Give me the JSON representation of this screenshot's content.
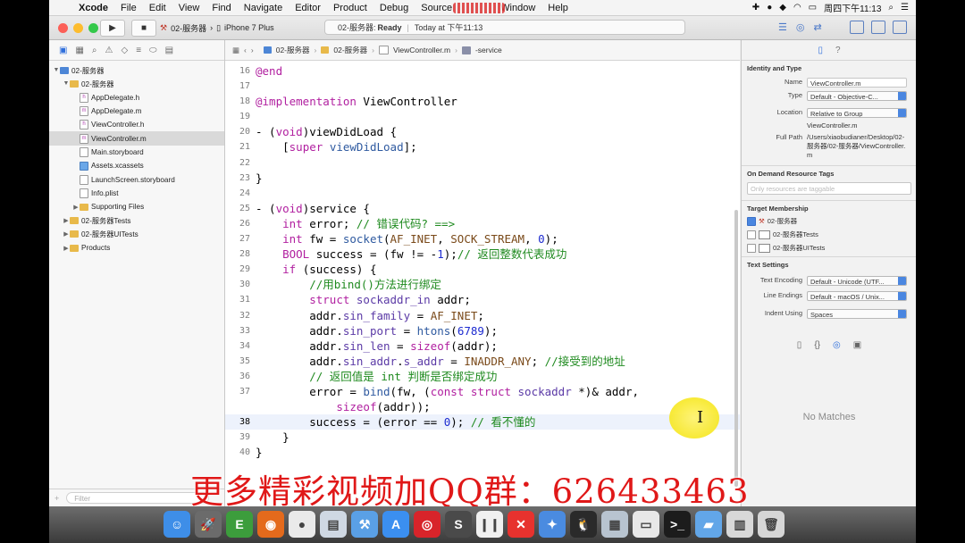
{
  "menubar": {
    "app_name": "Xcode",
    "items": [
      "File",
      "Edit",
      "View",
      "Find",
      "Navigate",
      "Editor",
      "Product",
      "Debug",
      "Source",
      "Window",
      "Help"
    ],
    "clock": "周四下午11:13"
  },
  "toolbar": {
    "scheme": "02-服务器",
    "device": "iPhone 7 Plus",
    "status_project": "02-服务器:",
    "status_text": "Ready",
    "status_time": "Today at 下午11:13",
    "colors": {
      "close": "#fc5f57",
      "minimize": "#fdbc2e",
      "zoom": "#34c84a",
      "accent": "#2f6fdc"
    }
  },
  "navigator": {
    "tree": [
      {
        "label": "02-服务器",
        "icon": "project-icon",
        "depth": 0,
        "expanded": true
      },
      {
        "label": "02-服务器",
        "icon": "folder-icon",
        "depth": 1,
        "expanded": true
      },
      {
        "label": "AppDelegate.h",
        "icon": "header-file-icon",
        "badge": "h",
        "depth": 2
      },
      {
        "label": "AppDelegate.m",
        "icon": "source-file-icon",
        "badge": "m",
        "depth": 2
      },
      {
        "label": "ViewController.h",
        "icon": "header-file-icon",
        "badge": "h",
        "depth": 2
      },
      {
        "label": "ViewController.m",
        "icon": "source-file-icon",
        "badge": "m",
        "depth": 2,
        "selected": true
      },
      {
        "label": "Main.storyboard",
        "icon": "storyboard-icon",
        "depth": 2
      },
      {
        "label": "Assets.xcassets",
        "icon": "assets-icon",
        "depth": 2
      },
      {
        "label": "LaunchScreen.storyboard",
        "icon": "storyboard-icon",
        "depth": 2
      },
      {
        "label": "Info.plist",
        "icon": "plist-icon",
        "depth": 2
      },
      {
        "label": "Supporting Files",
        "icon": "folder-icon",
        "depth": 2,
        "collapsed": true
      },
      {
        "label": "02-服务器Tests",
        "icon": "folder-icon",
        "depth": 1,
        "collapsed": true
      },
      {
        "label": "02-服务器UITests",
        "icon": "folder-icon",
        "depth": 1,
        "collapsed": true
      },
      {
        "label": "Products",
        "icon": "folder-icon",
        "depth": 1,
        "collapsed": true
      }
    ],
    "filter_placeholder": "Filter"
  },
  "jumpbar": {
    "crumbs": [
      "02-服务器",
      "02-服务器",
      "ViewController.m",
      "-service"
    ]
  },
  "code": {
    "lines": [
      {
        "n": "16",
        "html": "<span class=\"kw\">@end</span>"
      },
      {
        "n": "17",
        "html": ""
      },
      {
        "n": "18",
        "html": "<span class=\"kw\">@implementation</span> ViewController"
      },
      {
        "n": "19",
        "html": ""
      },
      {
        "n": "20",
        "html": "- (<span class=\"kw\">void</span>)viewDidLoad {"
      },
      {
        "n": "21",
        "html": "    [<span class=\"kw\">super</span> <span class=\"fn\">viewDidLoad</span>];"
      },
      {
        "n": "22",
        "html": ""
      },
      {
        "n": "23",
        "html": "}"
      },
      {
        "n": "24",
        "html": ""
      },
      {
        "n": "25",
        "html": "- (<span class=\"kw\">void</span>)service {"
      },
      {
        "n": "26",
        "html": "    <span class=\"kw\">int</span> error; <span class=\"cm\">// 错误代码? ==></span>"
      },
      {
        "n": "27",
        "html": "    <span class=\"kw\">int</span> fw = <span class=\"fn\">socket</span>(<span class=\"pp\">AF_INET</span>, <span class=\"pp\">SOCK_STREAM</span>, <span class=\"num\">0</span>);"
      },
      {
        "n": "28",
        "html": "    <span class=\"kw\">BOOL</span> success = (fw != -<span class=\"num\">1</span>);<span class=\"cm\">// 返回整数代表成功</span>"
      },
      {
        "n": "29",
        "html": "    <span class=\"kw\">if</span> (success) {"
      },
      {
        "n": "30",
        "html": "        <span class=\"cm\">//用bind()方法进行绑定</span>"
      },
      {
        "n": "31",
        "html": "        <span class=\"kw\">struct</span> <span class=\"ty\">sockaddr_in</span> addr;"
      },
      {
        "n": "32",
        "html": "        addr.<span class=\"ty\">sin_family</span> = <span class=\"pp\">AF_INET</span>;"
      },
      {
        "n": "33",
        "html": "        addr.<span class=\"ty\">sin_port</span> = <span class=\"fn\">htons</span>(<span class=\"num\">6789</span>);"
      },
      {
        "n": "34",
        "html": "        addr.<span class=\"ty\">sin_len</span> = <span class=\"kw\">sizeof</span>(addr);"
      },
      {
        "n": "35",
        "html": "        addr.<span class=\"ty\">sin_addr</span>.<span class=\"ty\">s_addr</span> = <span class=\"pp\">INADDR_ANY</span>; <span class=\"cm\">//接受到的地址</span>"
      },
      {
        "n": "36",
        "html": "        <span class=\"cm\">// 返回值是 int 判断是否绑定成功</span>"
      },
      {
        "n": "37",
        "html": "        error = <span class=\"fn\">bind</span>(fw, (<span class=\"kw\">const struct</span> <span class=\"ty\">sockaddr</span> *)&amp; addr,"
      },
      {
        "n": "",
        "html": "            <span class=\"kw\">sizeof</span>(addr));"
      },
      {
        "n": "38",
        "html": "        success = (error == <span class=\"num\">0</span>); <span class=\"cm\">// 看不懂的</span>",
        "current": true
      },
      {
        "n": "39",
        "html": "    }"
      },
      {
        "n": "40",
        "html": "}"
      }
    ]
  },
  "inspector": {
    "identity_title": "Identity and Type",
    "name_label": "Name",
    "name_value": "ViewController.m",
    "type_label": "Type",
    "type_value": "Default - Objective-C...",
    "location_label": "Location",
    "location_value": "Relative to Group",
    "location_file": "ViewController.m",
    "fullpath_label": "Full Path",
    "fullpath_value": "/Users/xiaobudianer/Desktop/02-服务器/02-服务器/ViewController.m",
    "odr_title": "On Demand Resource Tags",
    "odr_placeholder": "Only resources are taggable",
    "target_title": "Target Membership",
    "targets": [
      {
        "label": "02-服务器",
        "checked": true
      },
      {
        "label": "02-服务器Tests",
        "checked": false
      },
      {
        "label": "02-服务器UITests",
        "checked": false
      }
    ],
    "text_title": "Text Settings",
    "encoding_label": "Text Encoding",
    "encoding_value": "Default - Unicode (UTF...",
    "endings_label": "Line Endings",
    "endings_value": "Default - macOS / Unix...",
    "indent_label": "Indent Using",
    "indent_value": "Spaces",
    "no_matches": "No Matches"
  },
  "watermark": "更多精彩视频加QQ群：626433463",
  "dock": {
    "apps": [
      {
        "name": "finder-icon",
        "color": "#3e8ee8",
        "glyph": "☺"
      },
      {
        "name": "launchpad-icon",
        "color": "#6b6b6b",
        "glyph": "🚀"
      },
      {
        "name": "evernote-icon",
        "color": "#3c9d3c",
        "glyph": "E"
      },
      {
        "name": "firefox-icon",
        "color": "#e46a1c",
        "glyph": "◉"
      },
      {
        "name": "wechat-icon",
        "color": "#eaeaea",
        "glyph": "●"
      },
      {
        "name": "preview-icon",
        "color": "#cfd8e3",
        "glyph": "▤"
      },
      {
        "name": "xcode-icon",
        "color": "#5aa0e6",
        "glyph": "⚒"
      },
      {
        "name": "appstore-icon",
        "color": "#3b8ff0",
        "glyph": "A"
      },
      {
        "name": "netease-music-icon",
        "color": "#d8242a",
        "glyph": "◎"
      },
      {
        "name": "sublime-icon",
        "color": "#4a4a4a",
        "glyph": "S"
      },
      {
        "name": "book-icon",
        "color": "#f0f0f0",
        "glyph": "❙❙"
      },
      {
        "name": "xmind-icon",
        "color": "#e7322e",
        "glyph": "✕"
      },
      {
        "name": "instruments-icon",
        "color": "#4a8be0",
        "glyph": "✦"
      },
      {
        "name": "qq-icon",
        "color": "#2a2a2a",
        "glyph": "🐧"
      },
      {
        "name": "photo-icon",
        "color": "#b8c4d0",
        "glyph": "▦"
      },
      {
        "name": "notes-icon",
        "color": "#e8e8e8",
        "glyph": "▭"
      },
      {
        "name": "terminal-icon",
        "color": "#1c1c1c",
        "glyph": ">_"
      },
      {
        "name": "folder-dock-icon",
        "color": "#62a6e8",
        "glyph": "▰"
      },
      {
        "name": "downloads-icon",
        "color": "#d8d8d8",
        "glyph": "▥"
      },
      {
        "name": "trash-icon",
        "color": "#d6d6d6",
        "glyph": "🗑"
      }
    ]
  }
}
